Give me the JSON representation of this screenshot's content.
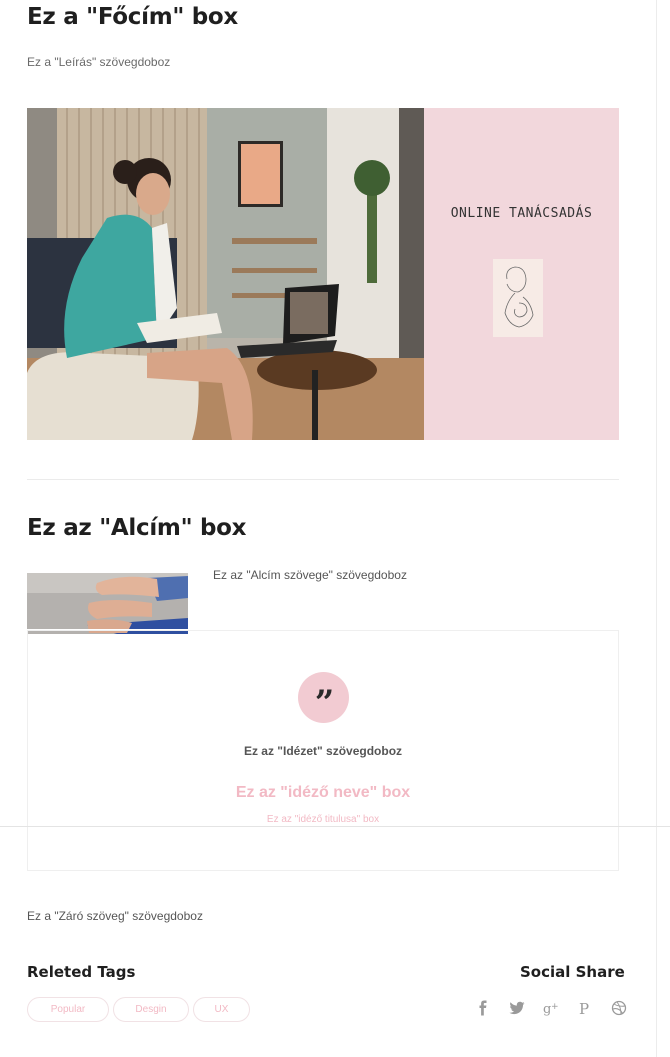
{
  "main_title": "Ez a \"Főcím\" box",
  "description": "Ez a \"Leírás\" szövegdoboz",
  "hero": {
    "panel_title": "ONLINE TANÁCSADÁS"
  },
  "subtitle": "Ez az \"Alcím\" box",
  "subtitle_text": "Ez az \"Alcím szövege\" szövegdoboz",
  "quote": {
    "icon": "quote-icon",
    "text": "Ez az \"Idézet\" szövegdoboz",
    "author_name": "Ez az \"idéző neve\" box",
    "author_title": "Ez az \"idéző titulusa\" box"
  },
  "closing_text": "Ez a \"Záró szöveg\" szövegdoboz",
  "tags": {
    "title": "Releted Tags",
    "items": [
      "Popular",
      "Desgin",
      "UX"
    ]
  },
  "social": {
    "title": "Social Share",
    "icons": [
      "facebook-icon",
      "twitter-icon",
      "google-plus-icon",
      "pinterest-icon",
      "dribbble-icon"
    ]
  },
  "colors": {
    "accent_pink": "#f2b9c4",
    "panel_pink": "#f2d7dc",
    "quote_circle": "#f2cbd2",
    "icon_gray": "#9a9a9a"
  }
}
